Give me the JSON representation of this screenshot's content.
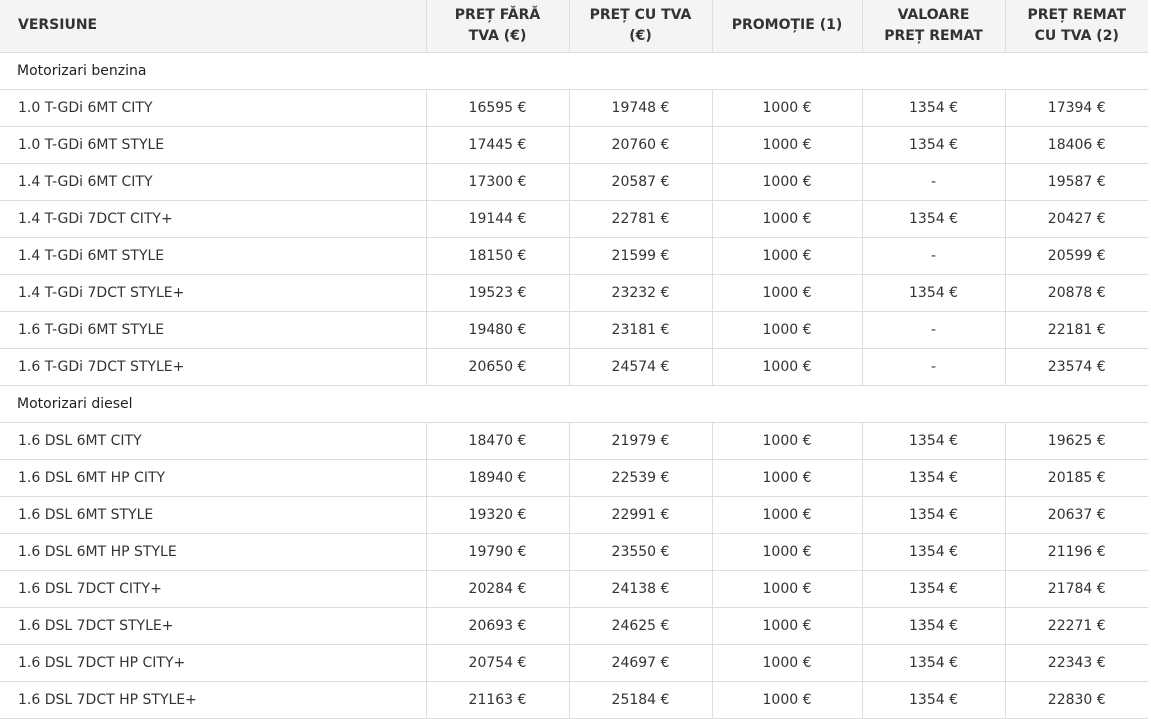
{
  "table": {
    "headers": [
      "VERSIUNE",
      "PREȚ FĂRĂ\nTVA (€)",
      "PREȚ CU TVA\n(€)",
      "PROMOȚIE (1)",
      "VALOARE\nPREȚ REMAT",
      "PREȚ REMAT\nCU TVA (2)"
    ],
    "sections": [
      {
        "title": "Motorizari benzina",
        "rows": [
          [
            "1.0 T-GDi 6MT CITY",
            "16595 €",
            "19748 €",
            "1000 €",
            "1354 €",
            "17394 €"
          ],
          [
            "1.0 T-GDi 6MT STYLE",
            "17445 €",
            "20760 €",
            "1000 €",
            "1354 €",
            "18406 €"
          ],
          [
            "1.4 T-GDi 6MT CITY",
            "17300 €",
            "20587 €",
            "1000 €",
            "-",
            "19587 €"
          ],
          [
            "1.4 T-GDi 7DCT CITY+",
            "19144 €",
            "22781 €",
            "1000 €",
            "1354 €",
            "20427 €"
          ],
          [
            "1.4 T-GDi 6MT STYLE",
            "18150 €",
            "21599 €",
            "1000 €",
            "-",
            "20599 €"
          ],
          [
            "1.4 T-GDi 7DCT STYLE+",
            "19523 €",
            "23232 €",
            "1000 €",
            "1354 €",
            "20878 €"
          ],
          [
            "1.6 T-GDi 6MT STYLE",
            "19480 €",
            "23181 €",
            "1000 €",
            "-",
            "22181 €"
          ],
          [
            "1.6 T-GDi 7DCT STYLE+",
            "20650 €",
            "24574 €",
            "1000 €",
            "-",
            "23574 €"
          ]
        ]
      },
      {
        "title": "Motorizari diesel",
        "rows": [
          [
            "1.6 DSL 6MT CITY",
            "18470 €",
            "21979 €",
            "1000 €",
            "1354 €",
            "19625 €"
          ],
          [
            "1.6 DSL 6MT HP CITY",
            "18940 €",
            "22539 €",
            "1000 €",
            "1354 €",
            "20185 €"
          ],
          [
            "1.6 DSL 6MT STYLE",
            "19320 €",
            "22991 €",
            "1000 €",
            "1354 €",
            "20637 €"
          ],
          [
            "1.6 DSL 6MT HP STYLE",
            "19790 €",
            "23550 €",
            "1000 €",
            "1354 €",
            "21196 €"
          ],
          [
            "1.6 DSL 7DCT CITY+",
            "20284 €",
            "24138 €",
            "1000 €",
            "1354 €",
            "21784 €"
          ],
          [
            "1.6 DSL 7DCT STYLE+",
            "20693 €",
            "24625 €",
            "1000 €",
            "1354 €",
            "22271 €"
          ],
          [
            "1.6 DSL 7DCT HP CITY+",
            "20754 €",
            "24697 €",
            "1000 €",
            "1354 €",
            "22343 €"
          ],
          [
            "1.6 DSL 7DCT HP STYLE+",
            "21163 €",
            "25184 €",
            "1000 €",
            "1354 €",
            "22830 €"
          ]
        ]
      }
    ]
  }
}
